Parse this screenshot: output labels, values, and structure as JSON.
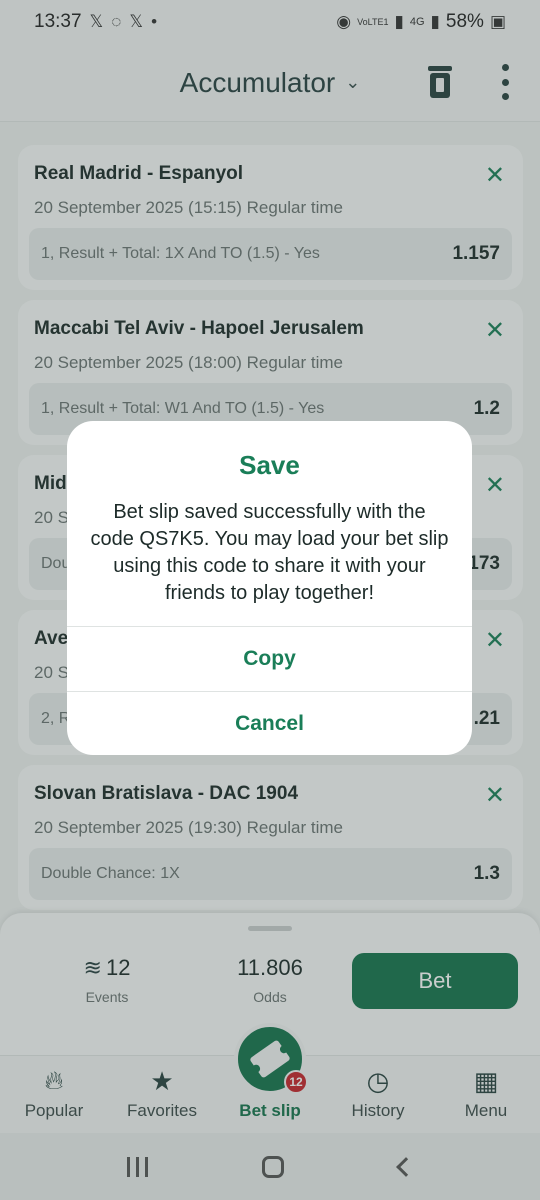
{
  "status_bar": {
    "time": "13:37",
    "network": "4G",
    "battery": "58%",
    "volte_label": "VoLTE1"
  },
  "header": {
    "title": "Accumulator"
  },
  "bets": [
    {
      "match": "Real Madrid - Espanyol",
      "date": "20 September 2025 (15:15) Regular time",
      "selection": "1, Result + Total: 1X And TO (1.5) - Yes",
      "odds": "1.157"
    },
    {
      "match": "Maccabi Tel Aviv - Hapoel Jerusalem",
      "date": "20 September 2025 (18:00) Regular time",
      "selection": "1, Result + Total: W1 And TO (1.5) - Yes",
      "odds": "1.2"
    },
    {
      "match": "Mid",
      "date": "20 S",
      "selection": "Dou",
      "odds": "173"
    },
    {
      "match": "Ave",
      "date": "20 S",
      "selection": "2, R",
      "odds": ".21"
    },
    {
      "match": "Slovan Bratislava - DAC 1904",
      "date": "20 September 2025 (19:30) Regular time",
      "selection": "Double Chance: 1X",
      "odds": "1.3"
    }
  ],
  "summary": {
    "events_count": "12",
    "events_label": "Events",
    "odds_value": "11.806",
    "odds_label": "Odds",
    "bet_label": "Bet"
  },
  "nav": {
    "popular": "Popular",
    "favorites": "Favorites",
    "betslip": "Bet slip",
    "betslip_badge": "12",
    "history": "History",
    "menu": "Menu"
  },
  "dialog": {
    "title": "Save",
    "message": "Bet slip saved successfully with the code QS7K5. You may load your bet slip using this code to share it with your friends to play together!",
    "copy_label": "Copy",
    "cancel_label": "Cancel"
  },
  "colors": {
    "accent": "#15734d",
    "badge": "#c6252b"
  }
}
